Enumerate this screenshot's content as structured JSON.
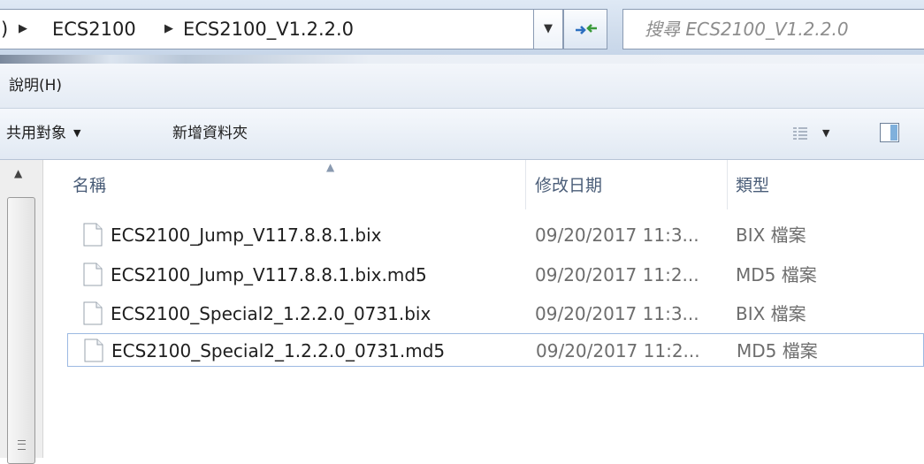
{
  "address_bar": {
    "breadcrumbs": [
      "ECS2100",
      "ECS2100_V1.2.2.0"
    ],
    "search_placeholder": "搜尋 ECS2100_V1.2.2.0"
  },
  "menu": {
    "help": "說明(H)"
  },
  "toolbar": {
    "share": "共用對象",
    "new_folder": "新增資料夾"
  },
  "columns": {
    "name": "名稱",
    "modified": "修改日期",
    "type": "類型"
  },
  "files": [
    {
      "name": "ECS2100_Jump_V117.8.8.1.bix",
      "modified": "09/20/2017 11:3...",
      "type": "BIX 檔案"
    },
    {
      "name": "ECS2100_Jump_V117.8.8.1.bix.md5",
      "modified": "09/20/2017 11:2...",
      "type": "MD5 檔案"
    },
    {
      "name": "ECS2100_Special2_1.2.2.0_0731.bix",
      "modified": "09/20/2017 11:3...",
      "type": "BIX 檔案"
    },
    {
      "name": "ECS2100_Special2_1.2.2.0_0731.md5",
      "modified": "09/20/2017 11:2...",
      "type": "MD5 檔案"
    }
  ],
  "icons": [
    "breadcrumb-arrow-icon",
    "refresh-icon",
    "view-options-icon",
    "preview-pane-icon",
    "file-icon",
    "scroll-up-icon",
    "sort-ascending-icon"
  ]
}
